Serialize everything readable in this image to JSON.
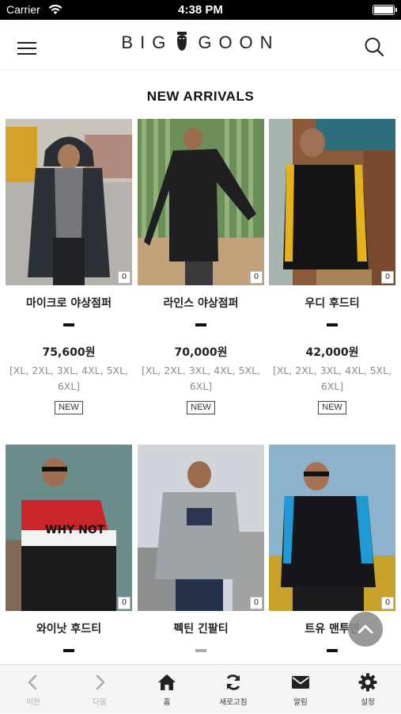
{
  "status_bar": {
    "carrier": "Carrier",
    "time": "4:38 PM"
  },
  "header": {
    "logo_left": "BIG",
    "logo_right": "GOON"
  },
  "section": {
    "title": "NEW ARRIVALS"
  },
  "products": [
    {
      "name": "마이크로 야상점퍼",
      "price": "75,600원",
      "sizes": "[XL, 2XL, 3XL, 4XL, 5XL, 6XL]",
      "badge": "NEW",
      "count": "0"
    },
    {
      "name": "라인스 야상점퍼",
      "price": "70,000원",
      "sizes": "[XL, 2XL, 3XL, 4XL, 5XL, 6XL]",
      "badge": "NEW",
      "count": "0"
    },
    {
      "name": "우디 후드티",
      "price": "42,000원",
      "sizes": "[XL, 2XL, 3XL, 4XL, 5XL, 6XL]",
      "badge": "NEW",
      "count": "0"
    },
    {
      "name": "와이낫 후드티",
      "count": "0",
      "print": "WHY NOT"
    },
    {
      "name": "펙틴 긴팔티",
      "count": "0"
    },
    {
      "name": "트유 맨투맨",
      "count": "0"
    }
  ],
  "tabbar": {
    "prev": "이전",
    "next": "다음",
    "home": "홈",
    "refresh": "새로고침",
    "notify": "알림",
    "settings": "설정"
  }
}
